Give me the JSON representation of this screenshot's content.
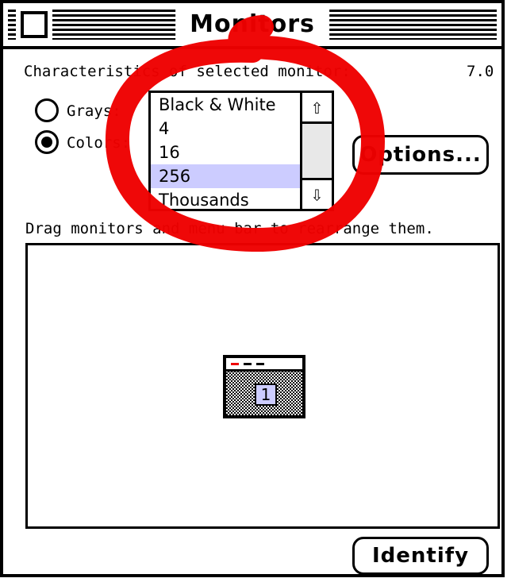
{
  "window": {
    "title": "Monitors"
  },
  "header": {
    "characteristics_label": "Characteristics of selected monitor:",
    "version": "7.0"
  },
  "mode": {
    "grays_label": "Grays:",
    "colors_label": "Colors:",
    "selected": "colors"
  },
  "depth_list": {
    "items": [
      "Black & White",
      "4",
      "16",
      "256",
      "Thousands"
    ],
    "selected": "256",
    "scroll_up_icon": "up-arrow-icon",
    "scroll_down_icon": "down-arrow-icon"
  },
  "buttons": {
    "options": "Options...",
    "identify": "Identify"
  },
  "arrange": {
    "instruction": "Drag monitors and menu bar to rearrange them.",
    "monitor_number": "1"
  },
  "colors": {
    "selection": "#ccccff",
    "annotation": "#ee0000"
  }
}
